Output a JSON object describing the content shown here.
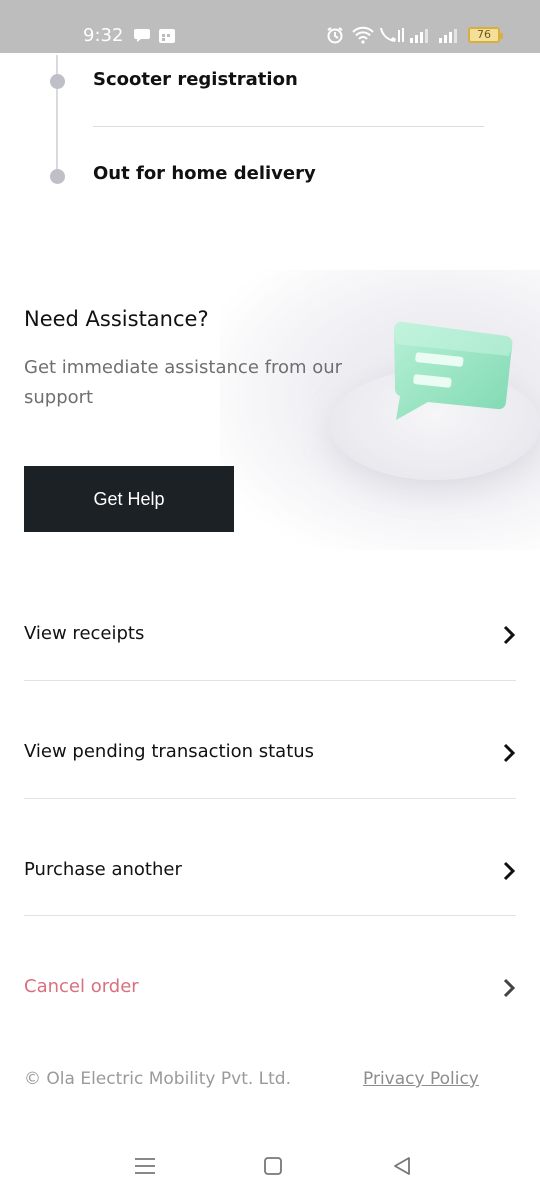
{
  "status_bar": {
    "time": "9:32",
    "battery_level": "76",
    "icons": [
      "chat-bubble-icon",
      "calendar-icon",
      "alarm-icon",
      "wifi-icon",
      "call-icon",
      "signal-icon",
      "signal-icon",
      "battery-icon"
    ]
  },
  "timeline": {
    "steps": [
      {
        "label": "Scooter registration"
      },
      {
        "label": "Out for home delivery"
      }
    ]
  },
  "assistance": {
    "title": "Need Assistance?",
    "description": "Get immediate assistance from our support",
    "button_label": "Get Help",
    "illustration_icon": "chat-message-icon",
    "accent_color": "#9be3c3"
  },
  "actions": [
    {
      "label": "View receipts",
      "icon": "chevron-right-icon"
    },
    {
      "label": "View pending transaction status",
      "icon": "chevron-right-icon"
    },
    {
      "label": "Purchase another",
      "icon": "chevron-right-icon"
    },
    {
      "label": "Cancel order",
      "icon": "chevron-right-icon",
      "color": "#d9707e"
    }
  ],
  "footer": {
    "copyright": "© Ola Electric Mobility Pvt. Ltd.",
    "privacy_link": "Privacy Policy"
  },
  "nav_bar": {
    "icons": [
      "menu-icon",
      "home-icon",
      "back-icon"
    ]
  }
}
